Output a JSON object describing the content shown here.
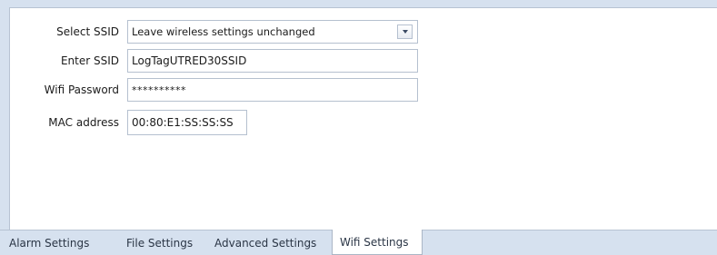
{
  "form": {
    "select_ssid": {
      "label": "Select SSID",
      "value": "Leave wireless settings unchanged"
    },
    "enter_ssid": {
      "label": "Enter SSID",
      "value": "LogTagUTRED30SSID"
    },
    "wifi_password": {
      "label": "Wifi Password",
      "value": "**********"
    },
    "mac_address": {
      "label": "MAC address",
      "value": "00:80:E1:SS:SS:SS"
    }
  },
  "tabs": [
    {
      "label": "Alarm Settings",
      "active": false
    },
    {
      "label": "File Settings",
      "active": false
    },
    {
      "label": "Advanced Settings",
      "active": false
    },
    {
      "label": "Wifi Settings",
      "active": true
    }
  ],
  "colors": {
    "background": "#d6e1ef",
    "panel": "#ffffff",
    "border": "#b5c0cf"
  }
}
